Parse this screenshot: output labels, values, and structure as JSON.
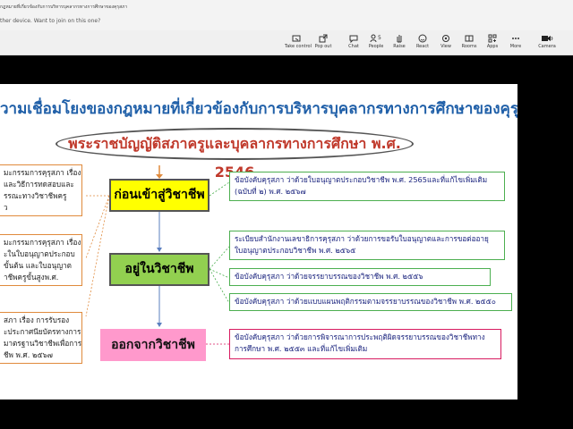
{
  "window": {
    "title": "กฎหมายที่เกี่ยวข้องกับการบริหารบุคลากรทางการศึกษาของคุรุสภา",
    "notice": "ther device. Want to join on this one?"
  },
  "toolbar": {
    "buttons": [
      {
        "label": "Take control",
        "icon": "take-control-icon"
      },
      {
        "label": "Pop out",
        "icon": "pop-out-icon"
      },
      {
        "label": "Chat",
        "icon": "chat-icon"
      },
      {
        "label": "People",
        "icon": "people-icon",
        "badge": "5"
      },
      {
        "label": "Raise",
        "icon": "raise-hand-icon"
      },
      {
        "label": "React",
        "icon": "react-icon"
      },
      {
        "label": "View",
        "icon": "view-icon"
      },
      {
        "label": "Rooms",
        "icon": "rooms-icon"
      },
      {
        "label": "Apps",
        "icon": "apps-icon"
      },
      {
        "label": "More",
        "icon": "more-icon"
      },
      {
        "label": "Camera",
        "icon": "camera-icon"
      }
    ]
  },
  "slide": {
    "title": "วามเชื่อมโยงของกฎหมายที่เกี่ยวข้องกับการบริหารบุคลากรทางการศึกษาของคุรุสภา",
    "act": "พระราชบัญญัติสภาครูและบุคลากรทางการศึกษา พ.ศ. 2546",
    "stages": {
      "before": "ก่อนเข้าสู่วิชาชีพ",
      "during": "อยู่ในวิชาชีพ",
      "after": "ออกจากวิชาชีพ"
    },
    "left_boxes": [
      {
        "lines": [
          "มะกรรมการคุรุสภา  เรื่อง",
          "และวิธีการทดสอบและ",
          "รรณะทางวิชาชีพครู",
          "ว"
        ]
      },
      {
        "lines": [
          "มะกรรมการคุรุสภา  เรื่อง",
          "ะในใบอนุญาตประกอบ",
          "ขั้นต้น  และใบอนุญาต",
          "าชีพครูขั้นสูงพ.ศ."
        ]
      },
      {
        "lines": [
          "สภา  เรื่อง  การรับรอง",
          "ะประกาศนียบัตรทางการ",
          "มาตรฐานวิชาชีพเพื่อการ",
          "ชีพ  พ.ศ.  ๒๕๖๗"
        ]
      }
    ],
    "right_boxes": [
      {
        "lines": [
          "ข้อบังคับคุรุสภา  ว่าด้วยใบอนุญาตประกอบวิชาชีพ  พ.ศ.  2565และที่แก้ไขเพิ่มเติม",
          "(ฉบับที่  ๒)  พ.ศ.  ๒๕๖๗"
        ]
      },
      {
        "lines": [
          "ระเบียบสำนักงานเลขาธิการคุรุสภา  ว่าด้วยการขอรับใบอนุญาตและการขอต่ออายุ",
          "ใบอนุญาตประกอบวิชาชีพ  พ.ศ.  ๒๕๖๕"
        ]
      },
      {
        "lines": [
          "ข้อบังคับคุรุสภา  ว่าด้วยจรรยาบรรณของวิชาชีพ  พ.ศ.  ๒๕๕๖"
        ]
      },
      {
        "lines": [
          "ข้อบังคับคุรุสภา  ว่าด้วยแบบแผนพฤติกรรมตามจรรยาบรรณของวิชาชีพ  พ.ศ.  ๒๕๕๐"
        ]
      },
      {
        "lines": [
          "ข้อบังคับคุรุสภา  ว่าด้วยการพิจารณาการประพฤติผิดจรรยาบรรณของวิชาชีพทาง",
          "การศึกษา  พ.ศ.  ๒๕๕๓  และที่แก้ไขเพิ่มเติม"
        ]
      }
    ]
  },
  "colors": {
    "title": "#1f5fa8",
    "act_text": "#c0392b",
    "stage_before": "#ffff00",
    "stage_during": "#92d050",
    "stage_after": "#ff99cc",
    "left_border": "#e08a3c",
    "right_border_green": "#4caf50",
    "right_border_pink": "#d81b60"
  }
}
